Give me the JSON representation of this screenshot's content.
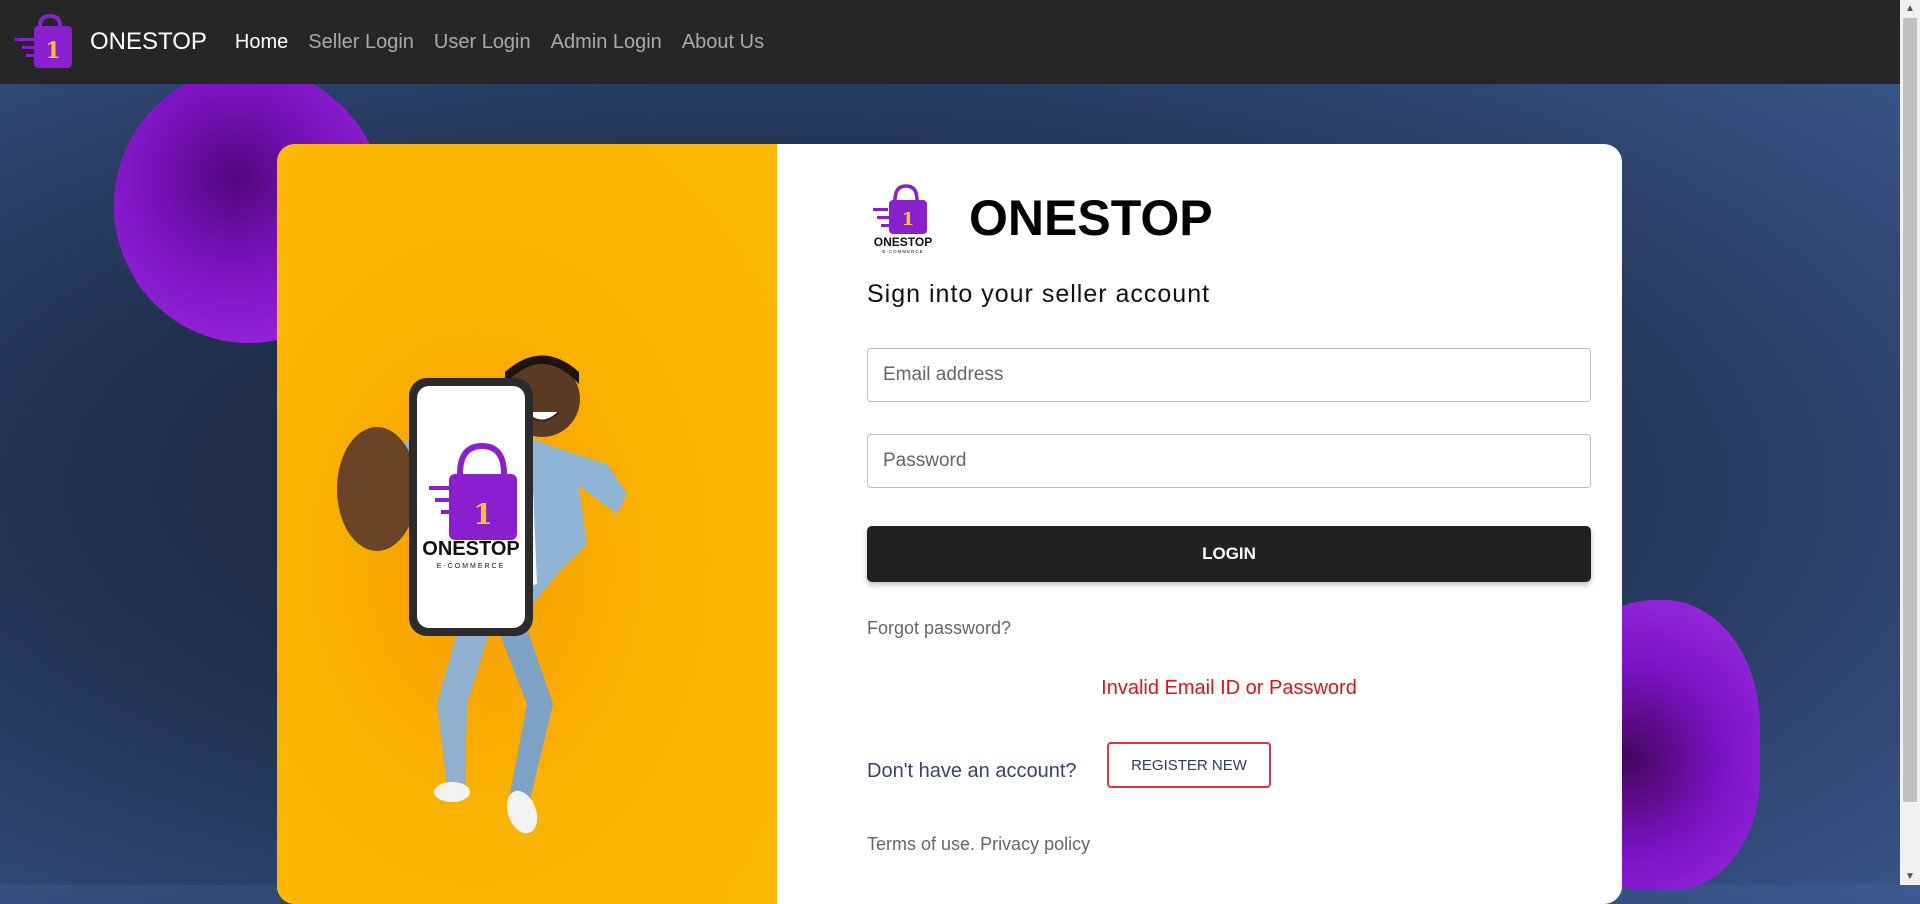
{
  "navbar": {
    "brand": "ONESTOP",
    "links": [
      "Home",
      "Seller Login",
      "User Login",
      "Admin Login",
      "About Us"
    ],
    "active": "Home"
  },
  "logo": {
    "badge_number": "1",
    "wordmark": "ONESTOP",
    "tagline": "E-COMMERCE"
  },
  "card": {
    "title": "ONESTOP",
    "subtitle": "Sign into your seller account",
    "email_placeholder": "Email address",
    "password_placeholder": "Password",
    "login_label": "LOGIN",
    "forgot_label": "Forgot password?",
    "error_message": "Invalid Email ID or Password",
    "no_account_label": "Don't have an account?",
    "register_label": "REGISTER NEW",
    "terms_label": "Terms of use.",
    "privacy_label": "Privacy policy"
  },
  "colors": {
    "navbar": "#262626",
    "accent_purple": "#8a1fcf",
    "hero_yellow": "#fbb400",
    "error": "#e0131c",
    "login_button": "#212121"
  }
}
